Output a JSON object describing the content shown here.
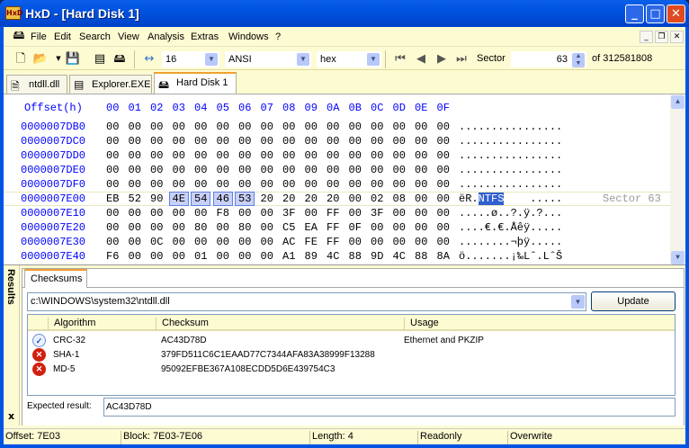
{
  "window": {
    "title": "HxD - [Hard Disk 1]",
    "app_icon_text": "HxD"
  },
  "menu": [
    "File",
    "Edit",
    "Search",
    "View",
    "Analysis",
    "Extras",
    "Windows",
    "?"
  ],
  "toolbar": {
    "bytes_per_row": "16",
    "charset": "ANSI",
    "display": "hex",
    "sector_label": "Sector",
    "sector_value": "63",
    "sector_total": "of 312581808"
  },
  "tabs": [
    {
      "label": "ntdll.dll",
      "active": false
    },
    {
      "label": "Explorer.EXE",
      "active": false
    },
    {
      "label": "Hard Disk 1",
      "active": true
    }
  ],
  "hex": {
    "header_offset": "Offset(h)",
    "header_cols": [
      "00",
      "01",
      "02",
      "03",
      "04",
      "05",
      "06",
      "07",
      "08",
      "09",
      "0A",
      "0B",
      "0C",
      "0D",
      "0E",
      "0F"
    ],
    "rows": [
      {
        "offset": "0000007DB0",
        "bytes": [
          "00",
          "00",
          "00",
          "00",
          "00",
          "00",
          "00",
          "00",
          "00",
          "00",
          "00",
          "00",
          "00",
          "00",
          "00",
          "00"
        ],
        "ascii": "................"
      },
      {
        "offset": "0000007DC0",
        "bytes": [
          "00",
          "00",
          "00",
          "00",
          "00",
          "00",
          "00",
          "00",
          "00",
          "00",
          "00",
          "00",
          "00",
          "00",
          "00",
          "00"
        ],
        "ascii": "................"
      },
      {
        "offset": "0000007DD0",
        "bytes": [
          "00",
          "00",
          "00",
          "00",
          "00",
          "00",
          "00",
          "00",
          "00",
          "00",
          "00",
          "00",
          "00",
          "00",
          "00",
          "00"
        ],
        "ascii": "................"
      },
      {
        "offset": "0000007DE0",
        "bytes": [
          "00",
          "00",
          "00",
          "00",
          "00",
          "00",
          "00",
          "00",
          "00",
          "00",
          "00",
          "00",
          "00",
          "00",
          "00",
          "00"
        ],
        "ascii": "................"
      },
      {
        "offset": "0000007DF0",
        "bytes": [
          "00",
          "00",
          "00",
          "00",
          "00",
          "00",
          "00",
          "00",
          "00",
          "00",
          "00",
          "00",
          "00",
          "00",
          "00",
          "00"
        ],
        "ascii": "................"
      },
      {
        "offset": "0000007E00",
        "bytes": [
          "EB",
          "52",
          "90",
          "4E",
          "54",
          "46",
          "53",
          "20",
          "20",
          "20",
          "20",
          "00",
          "02",
          "08",
          "00",
          "00"
        ],
        "ascii": "ëR.NTFS    .....",
        "sector_label": "Sector 63"
      },
      {
        "offset": "0000007E10",
        "bytes": [
          "00",
          "00",
          "00",
          "00",
          "00",
          "F8",
          "00",
          "00",
          "3F",
          "00",
          "FF",
          "00",
          "3F",
          "00",
          "00",
          "00"
        ],
        "ascii": ".....ø..?.ÿ.?..."
      },
      {
        "offset": "0000007E20",
        "bytes": [
          "00",
          "00",
          "00",
          "00",
          "80",
          "00",
          "80",
          "00",
          "C5",
          "EA",
          "FF",
          "0F",
          "00",
          "00",
          "00",
          "00"
        ],
        "ascii": "....€.€.Åêÿ....."
      },
      {
        "offset": "0000007E30",
        "bytes": [
          "00",
          "00",
          "0C",
          "00",
          "00",
          "00",
          "00",
          "00",
          "AC",
          "FE",
          "FF",
          "00",
          "00",
          "00",
          "00",
          "00"
        ],
        "ascii": "........¬þÿ....."
      },
      {
        "offset": "0000007E40",
        "bytes": [
          "F6",
          "00",
          "00",
          "00",
          "01",
          "00",
          "00",
          "00",
          "A1",
          "89",
          "4C",
          "88",
          "9D",
          "4C",
          "88",
          "8A"
        ],
        "ascii": "ö.......¡‰Lˆ.LˆŠ"
      }
    ]
  },
  "results": {
    "side_label": "Results",
    "close": "x",
    "tab": "Checksums",
    "path": "c:\\WINDOWS\\system32\\ntdll.dll",
    "update_label": "Update",
    "columns": [
      "Algorithm",
      "Checksum",
      "Usage"
    ],
    "rows": [
      {
        "status": "match",
        "algorithm": "CRC-32",
        "checksum": "AC43D78D",
        "usage": "Ethernet and PKZIP"
      },
      {
        "status": "mismatch",
        "algorithm": "SHA-1",
        "checksum": "379FD511C6C1EAAD77C7344AFA83A38999F13288",
        "usage": ""
      },
      {
        "status": "mismatch",
        "algorithm": "MD-5",
        "checksum": "95092EFBE367A108ECDD5D6E439754C3",
        "usage": ""
      }
    ],
    "expected_label": "Expected result:",
    "expected_value": "AC43D78D"
  },
  "status": {
    "offset": "Offset: 7E03",
    "block": "Block: 7E03-7E06",
    "length": "Length: 4",
    "mode": "Readonly",
    "write": "Overwrite"
  }
}
